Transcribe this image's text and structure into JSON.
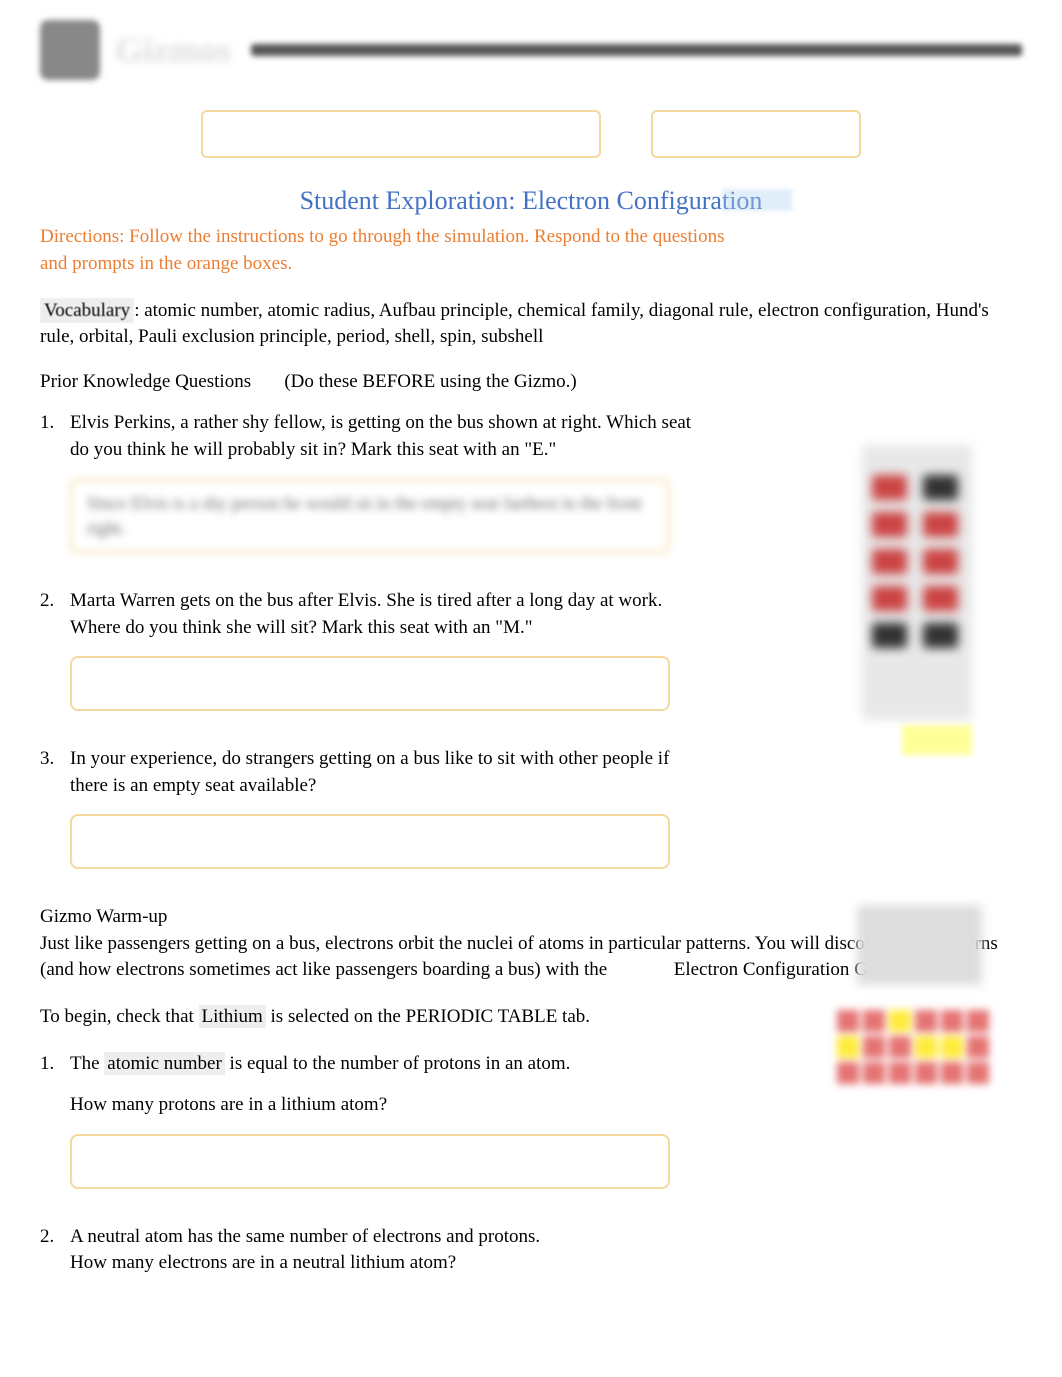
{
  "header": {
    "brand": "Gizmos"
  },
  "title": "Student Exploration: Electron Configuration",
  "directions": "Directions: Follow the instructions to go through the simulation. Respond to the questions and prompts in the orange boxes.",
  "vocabulary": {
    "label": "Vocabulary",
    "separator": ": ",
    "terms": "atomic number, atomic radius, Aufbau principle, chemical family, diagonal rule, electron configuration, Hund's rule, orbital, Pauli exclusion principle, period, shell, spin, subshell"
  },
  "priorKnowledge": {
    "label": "Prior Knowledge Questions",
    "note": "(Do these BEFORE using the Gizmo.)"
  },
  "questions": [
    {
      "number": "1.",
      "text": "Elvis Perkins, a rather shy fellow, is getting on the bus shown at right. Which seat do you think he will probably sit in? Mark this seat with an \"E.\"",
      "answer": "Since Elvis is a shy person he would sit in the empty seat farthest in the front right."
    },
    {
      "number": "2.",
      "text": "Marta Warren gets on the bus after Elvis. She is tired after a long day at work. Where do you think she will sit? Mark this seat with an \"M.\"",
      "answer": ""
    },
    {
      "number": "3.",
      "text": "In your experience, do strangers getting on a bus like to sit with other people if there is an empty seat available?",
      "answer": ""
    }
  ],
  "warmup": {
    "heading": "Gizmo Warm-up",
    "text1": "Just like passengers getting on a bus, electrons orbit the nuclei of atoms in particular patterns. You will discover these patterns (and how electrons sometimes act like passengers boarding a bus) with the ",
    "text1_cont1": "Electron Configuration",
    "text1_cont2": " Gizmo.",
    "text2_pre": "To begin, check that ",
    "text2_term": "Lithium",
    "text2_post": " is selected on the PERIODIC TABLE tab.",
    "questions": [
      {
        "number": "1.",
        "pre": "The ",
        "term": "atomic number",
        "post": " is equal to the number of protons in an atom.",
        "subquestion": "How many protons are in a lithium atom?",
        "answer": ""
      },
      {
        "number": "2.",
        "text": "A neutral atom has the same number of electrons and protons.",
        "subquestion": "How many electrons are in a neutral lithium atom?"
      }
    ]
  }
}
